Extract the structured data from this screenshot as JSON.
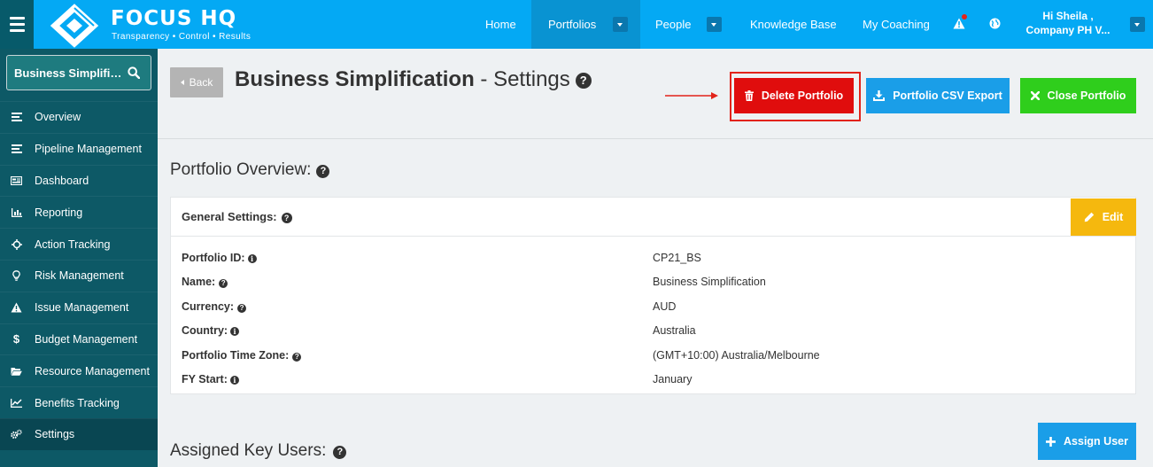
{
  "brand": {
    "name": "FOCUS HQ",
    "tagline": "Transparency • Control • Results"
  },
  "nav": {
    "items": [
      "Home",
      "Portfolios",
      "People",
      "Knowledge Base",
      "My Coaching"
    ],
    "user_greeting": "Hi Sheila ,",
    "user_company": "Company PH V..."
  },
  "sidebar": {
    "search_value": "Business Simplific...",
    "items": [
      {
        "label": "Overview",
        "icon": "list-icon"
      },
      {
        "label": "Pipeline Management",
        "icon": "list-icon"
      },
      {
        "label": "Dashboard",
        "icon": "dashboard-icon"
      },
      {
        "label": "Reporting",
        "icon": "bar-chart-icon"
      },
      {
        "label": "Action Tracking",
        "icon": "crosshair-icon"
      },
      {
        "label": "Risk Management",
        "icon": "lightbulb-icon"
      },
      {
        "label": "Issue Management",
        "icon": "warning-icon"
      },
      {
        "label": "Budget Management",
        "icon": "dollar-icon"
      },
      {
        "label": "Resource Management",
        "icon": "folder-icon"
      },
      {
        "label": "Benefits Tracking",
        "icon": "line-chart-icon"
      },
      {
        "label": "Settings",
        "icon": "gears-icon"
      }
    ],
    "active": "Settings"
  },
  "header": {
    "back_label": "Back",
    "title_bold": "Business Simplification",
    "title_rest": " - Settings",
    "delete_label": "Delete Portfolio",
    "csv_label": "Portfolio CSV Export",
    "close_label": "Close Portfolio"
  },
  "overview": {
    "title": "Portfolio Overview:",
    "general_title": "General Settings:",
    "edit_label": "Edit",
    "fields": [
      {
        "label": "Portfolio ID:",
        "value": "CP21_BS",
        "help": "info"
      },
      {
        "label": "Name:",
        "value": "Business Simplification",
        "help": "question"
      },
      {
        "label": "Currency:",
        "value": "AUD",
        "help": "question"
      },
      {
        "label": "Country:",
        "value": "Australia",
        "help": "info"
      },
      {
        "label": "Portfolio Time Zone:",
        "value": "(GMT+10:00) Australia/Melbourne",
        "help": "question"
      },
      {
        "label": "FY Start:",
        "value": "January",
        "help": "info"
      }
    ]
  },
  "key_users": {
    "title": "Assigned Key Users:",
    "assign_label": "Assign User"
  },
  "colors": {
    "navbar": "#04a9f4",
    "sidebar": "#0d5966",
    "delete": "#e00d0d",
    "csv": "#1a9ee8",
    "close": "#2fce1c",
    "edit": "#f5b80e"
  }
}
